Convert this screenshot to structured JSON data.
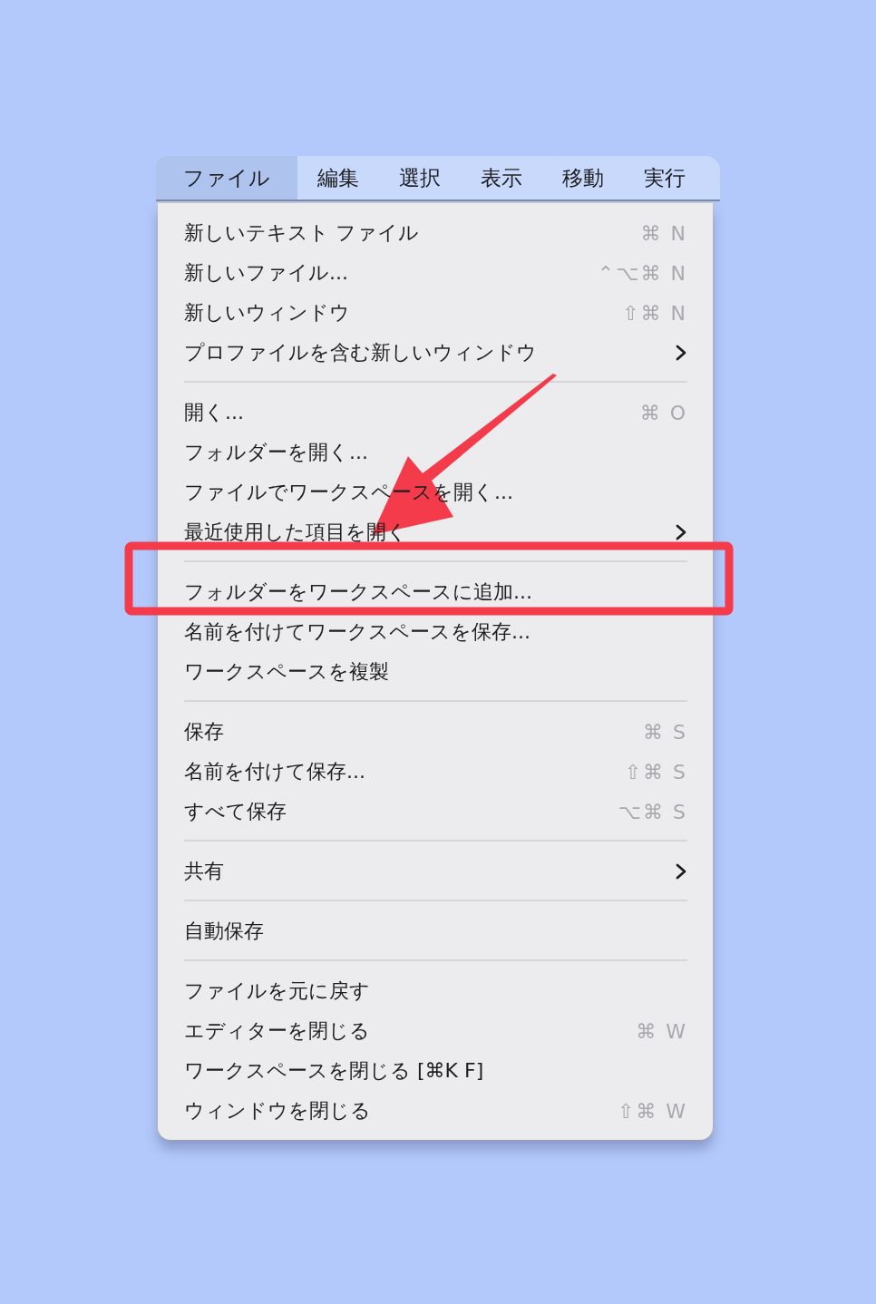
{
  "menu_bar": [
    {
      "label": "ファイル",
      "selected": true
    },
    {
      "label": "編集",
      "selected": false
    },
    {
      "label": "選択",
      "selected": false
    },
    {
      "label": "表示",
      "selected": false
    },
    {
      "label": "移動",
      "selected": false
    },
    {
      "label": "実行",
      "selected": false
    }
  ],
  "menu": {
    "sections": [
      {
        "items": [
          {
            "label": "新しいテキスト ファイル",
            "shortcut": "⌘ N",
            "submenu": false
          },
          {
            "label": "新しいファイル...",
            "shortcut": "⌃⌥⌘ N",
            "submenu": false
          },
          {
            "label": "新しいウィンドウ",
            "shortcut": "⇧⌘ N",
            "submenu": false
          },
          {
            "label": "プロファイルを含む新しいウィンドウ",
            "submenu": true
          }
        ]
      },
      {
        "items": [
          {
            "label": "開く...",
            "shortcut": "⌘ O",
            "submenu": false
          },
          {
            "label": "フォルダーを開く...",
            "submenu": false
          },
          {
            "label": "ファイルでワークスペースを開く...",
            "submenu": false
          },
          {
            "label": "最近使用した項目を開く",
            "submenu": true
          }
        ]
      },
      {
        "items": [
          {
            "label": "フォルダーをワークスペースに追加...",
            "submenu": false
          },
          {
            "label": "名前を付けてワークスペースを保存...",
            "submenu": false
          },
          {
            "label": "ワークスペースを複製",
            "submenu": false
          }
        ]
      },
      {
        "items": [
          {
            "label": "保存",
            "shortcut": "⌘ S",
            "submenu": false
          },
          {
            "label": "名前を付けて保存...",
            "shortcut": "⇧⌘ S",
            "submenu": false
          },
          {
            "label": "すべて保存",
            "shortcut": "⌥⌘ S",
            "submenu": false
          }
        ]
      },
      {
        "items": [
          {
            "label": "共有",
            "submenu": true
          }
        ]
      },
      {
        "items": [
          {
            "label": "自動保存",
            "submenu": false
          }
        ]
      },
      {
        "items": [
          {
            "label": "ファイルを元に戻す",
            "submenu": false
          },
          {
            "label": "エディターを閉じる",
            "shortcut": "⌘ W",
            "submenu": false
          },
          {
            "label": "ワークスペースを閉じる [⌘K F]",
            "submenu": false
          },
          {
            "label": "ウィンドウを閉じる",
            "shortcut": "⇧⌘ W",
            "submenu": false
          }
        ]
      }
    ]
  }
}
